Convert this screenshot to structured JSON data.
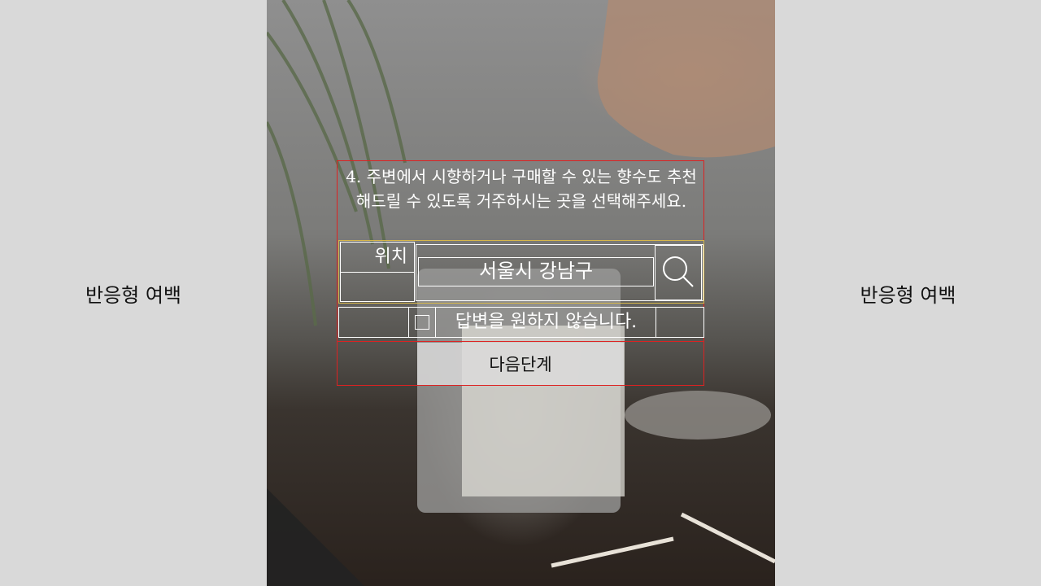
{
  "margins": {
    "left_label": "반응형 여백",
    "right_label": "반응형 여백"
  },
  "form": {
    "question": "4. 주변에서 시향하거나 구매할 수 있는 향수도 추천해드릴 수 있도록 거주하시는 곳을 선택해주세요.",
    "location_label": "위치",
    "location_value": "서울시 강남구",
    "search_icon": "search-icon",
    "opt_out_label": "답변을 원하지 않습니다.",
    "next_button": "다음단계"
  },
  "colors": {
    "outline": "#dd2222",
    "accent_outline": "#d6b64a",
    "text": "#ffffff"
  }
}
